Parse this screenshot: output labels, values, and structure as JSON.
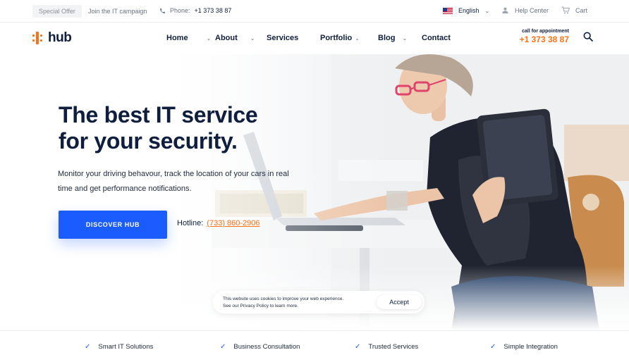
{
  "topbar": {
    "special_offer": "Special Offer",
    "campaign": "Join the IT campaign",
    "phone_label": "Phone:",
    "phone_number": "+1 373 38 87",
    "language": "English",
    "help": "Help Center",
    "cart": "Cart"
  },
  "nav": {
    "logo": "hub",
    "items": [
      {
        "label": "Home"
      },
      {
        "label": "About"
      },
      {
        "label": "Services"
      },
      {
        "label": "Portfolio"
      },
      {
        "label": "Blog"
      },
      {
        "label": "Contact"
      }
    ],
    "appointment_label": "call for appointment",
    "appointment_number": "+1 373 38 87"
  },
  "hero": {
    "headline_line1": "The best IT service",
    "headline_line2": "for your security.",
    "description": "Monitor your driving behavour, track the location of your cars in real time and get performance notifications.",
    "cta": "DISCOVER HUB",
    "hotline_label": "Hotline:",
    "hotline_number": "(733) 860-2906"
  },
  "cookie": {
    "line1": "This website uses cookies to improve your web experience.",
    "line2": "See our Privacy Policy to learn more.",
    "accept": "Accept"
  },
  "features": [
    {
      "label": "Smart IT Solutions"
    },
    {
      "label": "Business Consultation"
    },
    {
      "label": "Trusted Services"
    },
    {
      "label": "Simple Integration"
    }
  ],
  "colors": {
    "accent": "#1a5cff",
    "brand_orange": "#f97316",
    "navy": "#0f1e3d"
  }
}
